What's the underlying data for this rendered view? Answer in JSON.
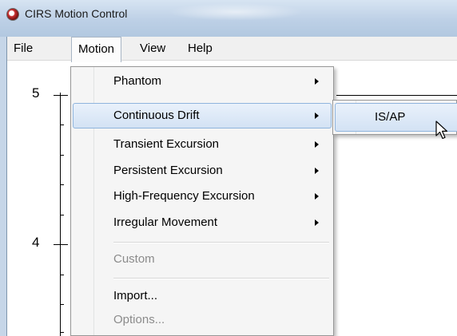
{
  "window": {
    "title": "CIRS Motion Control"
  },
  "menubar": {
    "items": [
      {
        "label": "File"
      },
      {
        "label": "Motion"
      },
      {
        "label": "View"
      },
      {
        "label": "Help"
      }
    ]
  },
  "plot": {
    "y_tick_labels": [
      "5",
      "4"
    ]
  },
  "motion_menu": {
    "items": [
      {
        "label": "Phantom",
        "submenu": true,
        "enabled": true
      },
      {
        "label": "Continuous Drift",
        "submenu": true,
        "enabled": true,
        "highlighted": true
      },
      {
        "label": "Transient Excursion",
        "submenu": true,
        "enabled": true
      },
      {
        "label": "Persistent Excursion",
        "submenu": true,
        "enabled": true
      },
      {
        "label": "High-Frequency Excursion",
        "submenu": true,
        "enabled": true
      },
      {
        "label": "Irregular Movement",
        "submenu": true,
        "enabled": true
      },
      {
        "label": "Custom",
        "submenu": false,
        "enabled": false
      },
      {
        "label": "Import...",
        "submenu": false,
        "enabled": true
      },
      {
        "label": "Options...",
        "submenu": false,
        "enabled": false
      }
    ]
  },
  "continuous_drift_submenu": {
    "items": [
      {
        "label": "IS/AP"
      }
    ]
  },
  "colors": {
    "highlight_border": "#8fb4dd",
    "highlight_fill": "#d3e2f4",
    "disabled_text": "#8b8b8b"
  },
  "icons": {
    "app": "app-logo-icon",
    "cursor": "mouse-pointer-icon"
  }
}
